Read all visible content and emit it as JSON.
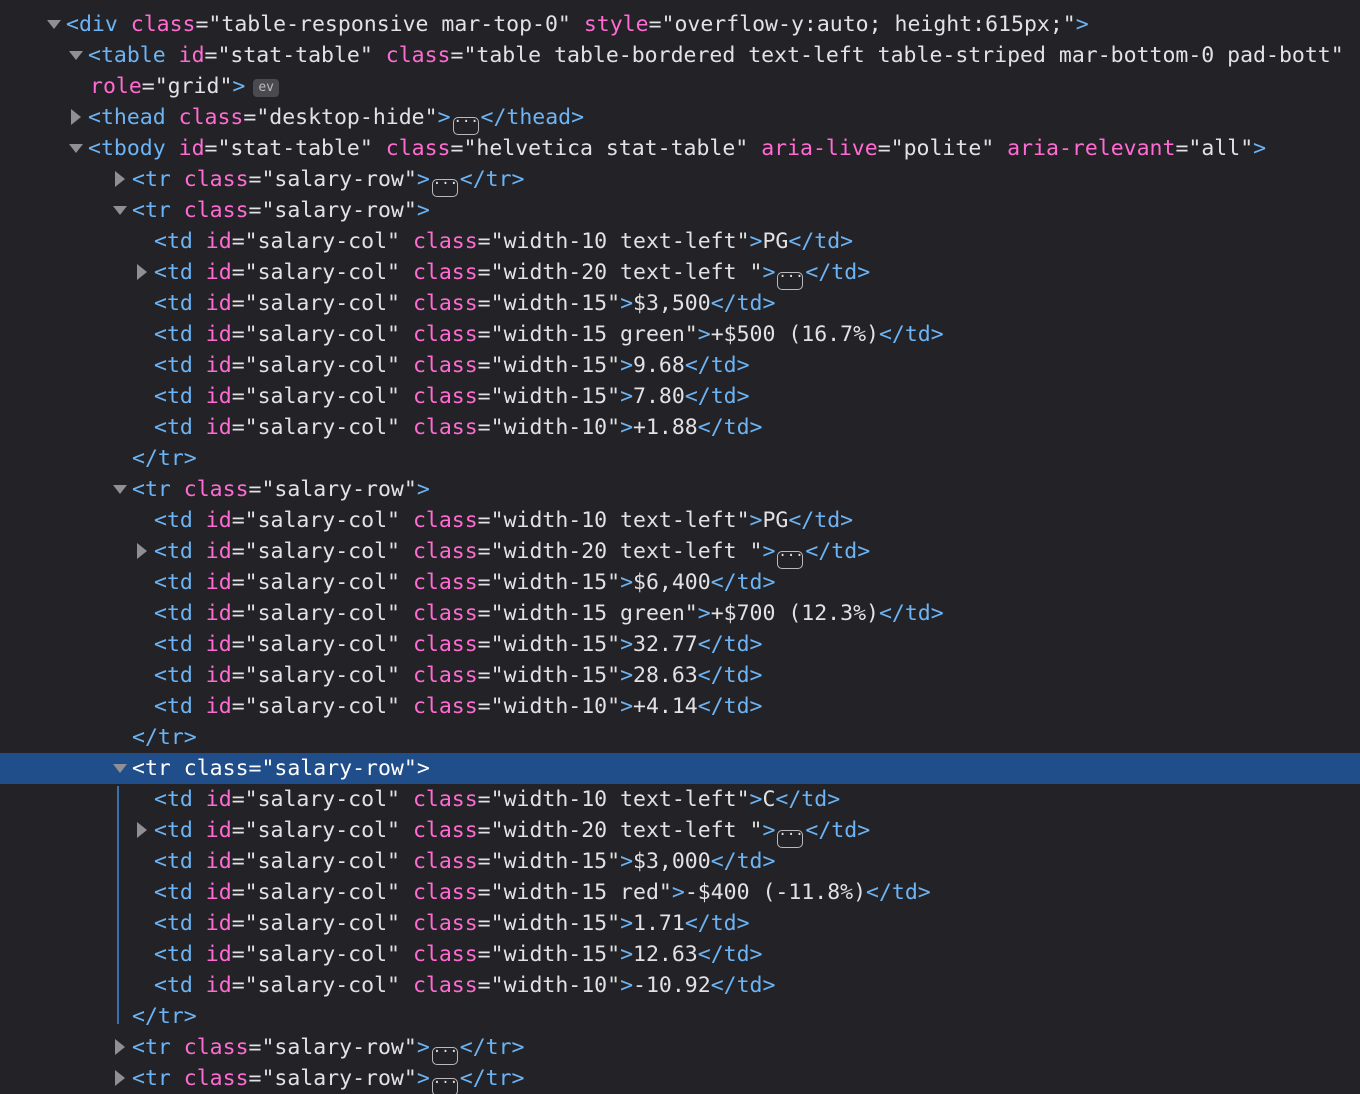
{
  "inspector": {
    "lines": [
      {
        "kind": "open",
        "indent": 0,
        "twisty": "expanded",
        "tag": "div",
        "attrs": [
          {
            "n": "class",
            "v": "table-responsive mar-top-0"
          },
          {
            "n": "style",
            "v": "overflow-y:auto; height:615px;"
          }
        ],
        "closer": ">"
      },
      {
        "kind": "open",
        "indent": 1,
        "twisty": "expanded",
        "tag": "table",
        "attrs": [
          {
            "n": "id",
            "v": "stat-table"
          },
          {
            "n": "class",
            "v": "table table-bordered text-left table-striped mar-bottom-0 pad-bott"
          }
        ],
        "closer": ""
      },
      {
        "kind": "cont",
        "indent": 1,
        "attrs": [
          {
            "n": "role",
            "v": "grid"
          }
        ],
        "closer": ">",
        "badge": "ev"
      },
      {
        "kind": "collapsed",
        "indent": 1,
        "twisty": "collapsed",
        "tag": "thead",
        "attrs": [
          {
            "n": "class",
            "v": "desktop-hide"
          }
        ]
      },
      {
        "kind": "open",
        "indent": 1,
        "twisty": "expanded",
        "tag": "tbody",
        "attrs": [
          {
            "n": "id",
            "v": "stat-table"
          },
          {
            "n": "class",
            "v": "helvetica stat-table"
          },
          {
            "n": "aria-live",
            "v": "polite"
          },
          {
            "n": "aria-relevant",
            "v": "all"
          }
        ],
        "closer": ">"
      },
      {
        "kind": "collapsed",
        "indent": 2,
        "twisty": "collapsed",
        "tag": "tr",
        "attrs": [
          {
            "n": "class",
            "v": "salary-row"
          }
        ]
      },
      {
        "kind": "open",
        "indent": 2,
        "twisty": "expanded",
        "tag": "tr",
        "attrs": [
          {
            "n": "class",
            "v": "salary-row"
          }
        ],
        "closer": ">"
      },
      {
        "kind": "td",
        "indent": 3,
        "cls": "width-10 text-left",
        "text": "PG"
      },
      {
        "kind": "tdc",
        "indent": 3,
        "twisty": "collapsed",
        "cls": "width-20 text-left "
      },
      {
        "kind": "td",
        "indent": 3,
        "cls": "width-15",
        "text": "$3,500"
      },
      {
        "kind": "td",
        "indent": 3,
        "cls": "width-15 green",
        "text": "+$500 (16.7%)"
      },
      {
        "kind": "td",
        "indent": 3,
        "cls": "width-15",
        "text": "9.68"
      },
      {
        "kind": "td",
        "indent": 3,
        "cls": "width-15",
        "text": "7.80"
      },
      {
        "kind": "td",
        "indent": 3,
        "cls": "width-10",
        "text": "+1.88"
      },
      {
        "kind": "close",
        "indent": 2,
        "tag": "tr"
      },
      {
        "kind": "open",
        "indent": 2,
        "twisty": "expanded",
        "tag": "tr",
        "attrs": [
          {
            "n": "class",
            "v": "salary-row"
          }
        ],
        "closer": ">"
      },
      {
        "kind": "td",
        "indent": 3,
        "cls": "width-10 text-left",
        "text": "PG"
      },
      {
        "kind": "tdc",
        "indent": 3,
        "twisty": "collapsed",
        "cls": "width-20 text-left "
      },
      {
        "kind": "td",
        "indent": 3,
        "cls": "width-15",
        "text": "$6,400"
      },
      {
        "kind": "td",
        "indent": 3,
        "cls": "width-15 green",
        "text": "+$700 (12.3%)"
      },
      {
        "kind": "td",
        "indent": 3,
        "cls": "width-15",
        "text": "32.77"
      },
      {
        "kind": "td",
        "indent": 3,
        "cls": "width-15",
        "text": "28.63"
      },
      {
        "kind": "td",
        "indent": 3,
        "cls": "width-10",
        "text": "+4.14"
      },
      {
        "kind": "close",
        "indent": 2,
        "tag": "tr"
      },
      {
        "kind": "open",
        "indent": 2,
        "twisty": "expanded",
        "tag": "tr",
        "attrs": [
          {
            "n": "class",
            "v": "salary-row"
          }
        ],
        "closer": ">",
        "selected": true
      },
      {
        "kind": "td",
        "indent": 3,
        "cls": "width-10 text-left",
        "text": "C"
      },
      {
        "kind": "tdc",
        "indent": 3,
        "twisty": "collapsed",
        "cls": "width-20 text-left "
      },
      {
        "kind": "td",
        "indent": 3,
        "cls": "width-15",
        "text": "$3,000"
      },
      {
        "kind": "td",
        "indent": 3,
        "cls": "width-15 red",
        "text": "-$400 (-11.8%)"
      },
      {
        "kind": "td",
        "indent": 3,
        "cls": "width-15",
        "text": "1.71"
      },
      {
        "kind": "td",
        "indent": 3,
        "cls": "width-15",
        "text": "12.63"
      },
      {
        "kind": "td",
        "indent": 3,
        "cls": "width-10",
        "text": "-10.92"
      },
      {
        "kind": "close",
        "indent": 2,
        "tag": "tr"
      },
      {
        "kind": "collapsed",
        "indent": 2,
        "twisty": "collapsed",
        "tag": "tr",
        "attrs": [
          {
            "n": "class",
            "v": "salary-row"
          }
        ]
      },
      {
        "kind": "collapsed",
        "indent": 2,
        "twisty": "collapsed",
        "tag": "tr",
        "attrs": [
          {
            "n": "class",
            "v": "salary-row"
          }
        ]
      }
    ],
    "td_id": "salary-col",
    "colors": {
      "background": "#232327",
      "tag": "#6cb4f5",
      "attr_name": "#ff6bd3",
      "attr_value": "#e2e2e5",
      "selection": "#204e8a"
    },
    "icons": {
      "collapsed_marker": "ellipsis-icon",
      "expand": "triangle-down-icon",
      "collapse": "triangle-right-icon"
    }
  }
}
